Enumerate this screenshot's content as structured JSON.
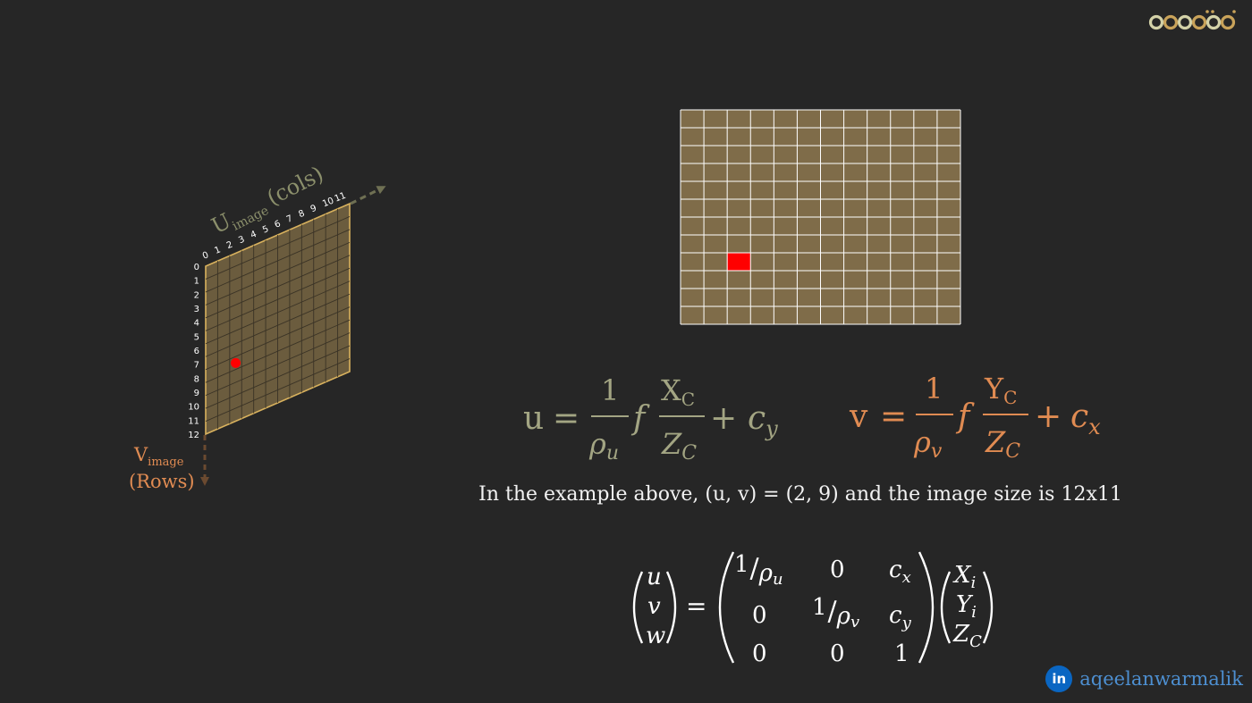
{
  "logo": {
    "text": "aqeeloc"
  },
  "perspective_grid": {
    "cols_label": "U",
    "cols_sub": "image",
    "cols_word": "(cols)",
    "rows_label": "V",
    "rows_sub": "image",
    "rows_word": "(Rows)",
    "col_ticks": [
      "0",
      "1",
      "2",
      "3",
      "4",
      "5",
      "6",
      "7",
      "8",
      "9",
      "10",
      "11"
    ],
    "row_ticks": [
      "0",
      "1",
      "2",
      "3",
      "4",
      "5",
      "6",
      "7",
      "8",
      "9",
      "10",
      "11",
      "12"
    ],
    "marked_pixel": {
      "u": 2,
      "v": 9
    },
    "colors": {
      "fill": "#6b5c3e",
      "edge": "#d9b25e",
      "marker": "#ff0000",
      "cols_axis": "#8b8f6b",
      "rows_axis": "#e08b52"
    }
  },
  "flat_grid": {
    "cols": 12,
    "rows": 12,
    "marked_col": 2,
    "marked_row": 8,
    "fill": "#7f6c49",
    "line": "#ffffff",
    "marker": "#ff0000"
  },
  "equations": {
    "u": {
      "lhs": "u",
      "eq": "=",
      "num": "1",
      "den": "ρ",
      "den_sub": "u",
      "f": "f",
      "frac_num": "X",
      "frac_num_sub": "C",
      "frac_den": "Z",
      "frac_den_sub": "C",
      "plus": "+",
      "c": "c",
      "c_sub": "y",
      "color": "#a3a583"
    },
    "v": {
      "lhs": "v",
      "eq": "=",
      "num": "1",
      "den": "ρ",
      "den_sub": "v",
      "f": "f",
      "frac_num": "Y",
      "frac_num_sub": "C",
      "frac_den": "Z",
      "frac_den_sub": "C",
      "plus": "+",
      "c": "c",
      "c_sub": "x",
      "color": "#e08b52"
    }
  },
  "caption": "In the example above, (u, v) = (2, 9) and the image size is 12x11",
  "matrix": {
    "lhs": [
      {
        "base": "u"
      },
      {
        "base": "v"
      },
      {
        "base": "w"
      }
    ],
    "eq": "=",
    "cells": [
      [
        {
          "num": "1",
          "slash": "/",
          "base": "ρ",
          "sub": "u"
        },
        {
          "base": "0"
        },
        {
          "base": "c",
          "sub": "x"
        }
      ],
      [
        {
          "base": "0"
        },
        {
          "num": "1",
          "slash": "/",
          "base": "ρ",
          "sub": "v"
        },
        {
          "base": "c",
          "sub": "y"
        }
      ],
      [
        {
          "base": "0"
        },
        {
          "base": "0"
        },
        {
          "base": "1"
        }
      ]
    ],
    "rhs": [
      {
        "base": "X",
        "sub": "i"
      },
      {
        "base": "Y",
        "sub": "i"
      },
      {
        "base": "Z",
        "sub": "C"
      }
    ]
  },
  "brand": {
    "badge": "in",
    "handle": "aqeelanwarmalik",
    "badge_color": "#0a66c2"
  }
}
